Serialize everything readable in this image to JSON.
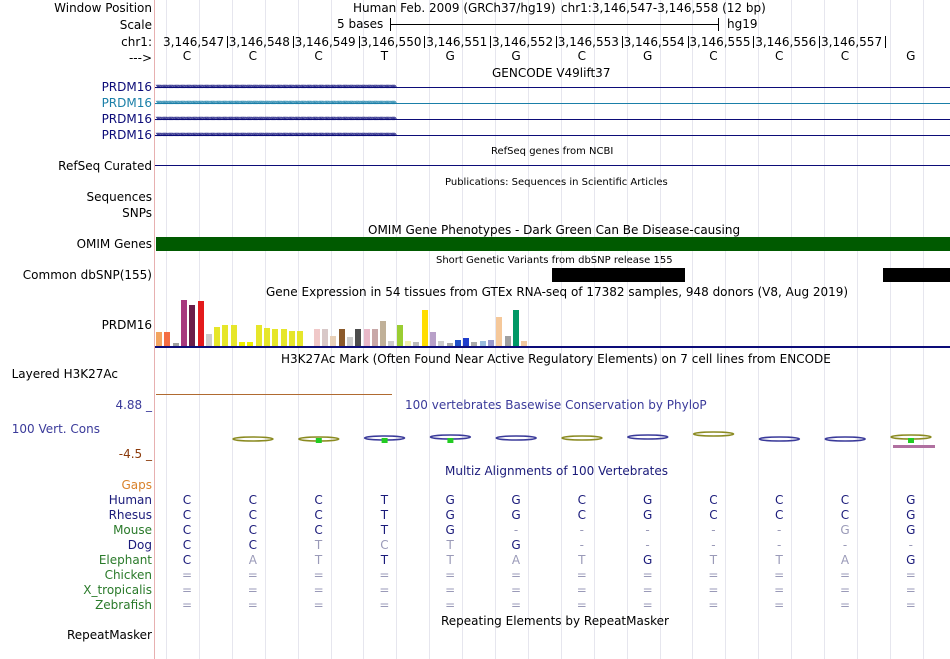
{
  "header": {
    "window_position_label": "Window Position",
    "scale_label": "Scale",
    "chrom_label": "chr1:",
    "strand_label": "--->",
    "assembly": "Human Feb. 2009 (GRCh37/hg19)",
    "position": "chr1:3,146,547-3,146,558 (12 bp)",
    "scale_text": "5 bases",
    "db": "hg19"
  },
  "ruler": {
    "ticks": [
      "3,146,547",
      "3,146,548",
      "3,146,549",
      "3,146,550",
      "3,146,551",
      "3,146,552",
      "3,146,553",
      "3,146,554",
      "3,146,555",
      "3,146,556",
      "3,146,557"
    ],
    "bases": [
      "C",
      "C",
      "C",
      "T",
      "G",
      "G",
      "C",
      "G",
      "C",
      "C",
      "C",
      "G"
    ]
  },
  "tracks": {
    "gencode": {
      "title": "GENCODE V49lift37",
      "genes": [
        {
          "label": "PRDM16",
          "color": "#0c0c78"
        },
        {
          "label": "PRDM16",
          "color": "#1a7fa8"
        },
        {
          "label": "PRDM16",
          "color": "#0c0c78"
        },
        {
          "label": "PRDM16",
          "color": "#0c0c78"
        }
      ]
    },
    "refseq": {
      "label": "RefSeq Curated",
      "title": "RefSeq genes from NCBI",
      "color": "#0c0c78"
    },
    "publications": {
      "label": "Sequences",
      "title": "Publications: Sequences in Scientific Articles"
    },
    "snps": {
      "label": "SNPs"
    },
    "omim": {
      "label": "OMIM Genes",
      "title": "OMIM Gene Phenotypes - Dark Green Can Be Disease-causing",
      "color": "#005a00"
    },
    "dbsnp": {
      "label": "Common dbSNP(155)",
      "title": "Short Genetic Variants from dbSNP release 155"
    },
    "gtex": {
      "label": "PRDM16",
      "title": "Gene Expression in 54 tissues from GTEx RNA-seq of 17382 samples, 948 donors (V8, Aug 2019)",
      "bars": [
        {
          "v": 0.3,
          "c": "#f3a45f"
        },
        {
          "v": 0.3,
          "c": "#f46d43"
        },
        {
          "v": 0.07,
          "c": "#a0a0a0"
        },
        {
          "v": 1.0,
          "c": "#a7387e"
        },
        {
          "v": 0.9,
          "c": "#6b1d4a"
        },
        {
          "v": 0.98,
          "c": "#e31a1c"
        },
        {
          "v": 0.25,
          "c": "#cccccc"
        },
        {
          "v": 0.42,
          "c": "#e6e62a"
        },
        {
          "v": 0.45,
          "c": "#e6e62a"
        },
        {
          "v": 0.45,
          "c": "#e6e62a"
        },
        {
          "v": 0.08,
          "c": "#eeee00"
        },
        {
          "v": 0.08,
          "c": "#eeee00"
        },
        {
          "v": 0.45,
          "c": "#e6e62a"
        },
        {
          "v": 0.4,
          "c": "#e6e62a"
        },
        {
          "v": 0.38,
          "c": "#e6e62a"
        },
        {
          "v": 0.36,
          "c": "#e6e62a"
        },
        {
          "v": 0.32,
          "c": "#e6e62a"
        },
        {
          "v": 0.32,
          "c": "#e6e62a"
        },
        {
          "v": 0.0,
          "c": "#ffffff"
        },
        {
          "v": 0.36,
          "c": "#f0c8c8"
        },
        {
          "v": 0.36,
          "c": "#d8c8c8"
        },
        {
          "v": 0.22,
          "c": "#e8d0b8"
        },
        {
          "v": 0.36,
          "c": "#8b5a2b"
        },
        {
          "v": 0.2,
          "c": "#cccccc"
        },
        {
          "v": 0.36,
          "c": "#4d4d4d"
        },
        {
          "v": 0.38,
          "c": "#e8b8c8"
        },
        {
          "v": 0.36,
          "c": "#c8a8a8"
        },
        {
          "v": 0.55,
          "c": "#c0b098"
        },
        {
          "v": 0.1,
          "c": "#cccccc"
        },
        {
          "v": 0.45,
          "c": "#9acd32"
        },
        {
          "v": 0.1,
          "c": "#f0f0b0"
        },
        {
          "v": 0.08,
          "c": "#bbbbbb"
        },
        {
          "v": 0.78,
          "c": "#ffdd00"
        },
        {
          "v": 0.3,
          "c": "#b8a0c8"
        },
        {
          "v": 0.1,
          "c": "#cccccc"
        },
        {
          "v": 0.06,
          "c": "#aaaaaa"
        },
        {
          "v": 0.12,
          "c": "#2050c8"
        },
        {
          "v": 0.18,
          "c": "#1e3ccc"
        },
        {
          "v": 0.08,
          "c": "#aaaaaa"
        },
        {
          "v": 0.1,
          "c": "#99bbdd"
        },
        {
          "v": 0.12,
          "c": "#9999cc"
        },
        {
          "v": 0.62,
          "c": "#f5c89a"
        },
        {
          "v": 0.22,
          "c": "#a0a0a0"
        },
        {
          "v": 0.78,
          "c": "#009966"
        },
        {
          "v": 0.1,
          "c": "#f0c8a0"
        }
      ]
    },
    "h3k27ac": {
      "label": "Layered H3K27Ac",
      "title": "H3K27Ac Mark (Often Found Near Active Regulatory Elements) on 7 cell lines from ENCODE"
    },
    "conservation": {
      "label": "100 Vert. Cons",
      "title": "100 vertebrates Basewise Conservation by PhyloP",
      "ymax": "4.88 _",
      "ymin": "-4.5 _",
      "color_positive": "#3a3a9a",
      "color_negative": "#8b3a0a"
    },
    "multiz": {
      "title": "Multiz Alignments of 100 Vertebrates",
      "gaps_label": "Gaps",
      "species": [
        {
          "name": "Human",
          "color": "#1a1a7a",
          "bases": [
            "C",
            "C",
            "C",
            "T",
            "G",
            "G",
            "C",
            "G",
            "C",
            "C",
            "C",
            "G"
          ]
        },
        {
          "name": "Rhesus",
          "color": "#1a1a7a",
          "bases": [
            "C",
            "C",
            "C",
            "T",
            "G",
            "G",
            "C",
            "G",
            "C",
            "C",
            "C",
            "G"
          ]
        },
        {
          "name": "Mouse",
          "color": "#2a7a2a",
          "bases": [
            "C",
            "C",
            "C",
            "T",
            "G",
            "-",
            "-",
            "-",
            "-",
            "-",
            "G",
            "G"
          ]
        },
        {
          "name": "Dog",
          "color": "#1a1a7a",
          "bases": [
            "C",
            "C",
            "T",
            "C",
            "T",
            "G",
            "-",
            "-",
            "-",
            "-",
            "-",
            "-"
          ]
        },
        {
          "name": "Elephant",
          "color": "#2a7a2a",
          "bases": [
            "C",
            "A",
            "T",
            "T",
            "T",
            "A",
            "T",
            "G",
            "T",
            "T",
            "A",
            "G"
          ]
        },
        {
          "name": "Chicken",
          "color": "#2a7a2a",
          "bases": [
            "=",
            "=",
            "=",
            "=",
            "=",
            "=",
            "=",
            "=",
            "=",
            "=",
            "=",
            "="
          ]
        },
        {
          "name": "X_tropicalis",
          "color": "#2a7a2a",
          "bases": [
            "=",
            "=",
            "=",
            "=",
            "=",
            "=",
            "=",
            "=",
            "=",
            "=",
            "=",
            "="
          ]
        },
        {
          "name": "Zebrafish",
          "color": "#2a7a2a",
          "bases": [
            "=",
            "=",
            "=",
            "=",
            "=",
            "=",
            "=",
            "=",
            "=",
            "=",
            "=",
            "="
          ]
        }
      ]
    },
    "repeatmasker": {
      "label": "RepeatMasker",
      "title": "Repeating Elements by RepeatMasker"
    }
  }
}
